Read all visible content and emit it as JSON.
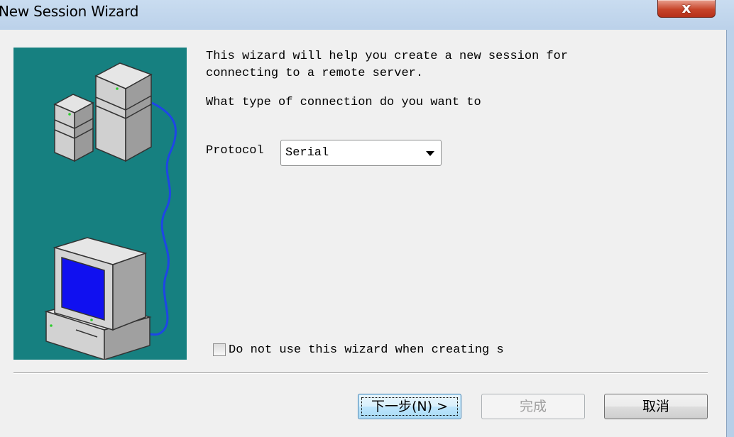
{
  "window": {
    "title": "New Session Wizard",
    "close_label": "x"
  },
  "content": {
    "intro_text": "This wizard will help you create a new session for\nconnecting to a remote server.",
    "question_text": "What type of connection do you want to",
    "protocol_label": "Protocol",
    "protocol_value": "Serial",
    "checkbox_label": "Do not use this wizard when creating s",
    "checkbox_checked": false
  },
  "buttons": {
    "next": "下一步(N) >",
    "finish": "完成",
    "cancel": "取消"
  },
  "colors": {
    "graphic_bg": "#168080",
    "cable": "#1e46e6",
    "monitor_screen": "#1010f0"
  }
}
